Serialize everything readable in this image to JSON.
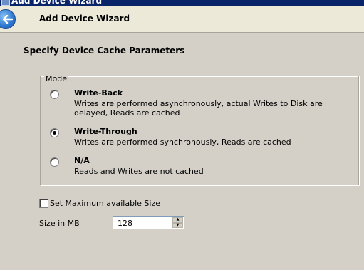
{
  "window": {
    "title": "Add Device Wizard"
  },
  "header": {
    "title": "Add Device Wizard"
  },
  "page": {
    "section_title": "Specify Device Cache Parameters"
  },
  "mode": {
    "legend": "Mode",
    "options": [
      {
        "title": "Write-Back",
        "description": "Writes are performed asynchronously, actual Writes to Disk are delayed, Reads are cached",
        "selected": false
      },
      {
        "title": "Write-Through",
        "description": "Writes are performed synchronously, Reads are cached",
        "selected": true
      },
      {
        "title": "N/A",
        "description": "Reads and Writes are not cached",
        "selected": false
      }
    ]
  },
  "max_size": {
    "label": "Set Maximum available Size",
    "checked": false
  },
  "size": {
    "label": "Size in MB",
    "value": "128"
  },
  "icons": {
    "back": "back-arrow-icon",
    "spin_up": "spin-up-icon",
    "spin_down": "spin-down-icon"
  },
  "colors": {
    "title_bar": "#0a246a",
    "header_bg": "#ece9d8",
    "dialog_bg": "#d4d0c8",
    "back_button": "#2f7cd3"
  }
}
